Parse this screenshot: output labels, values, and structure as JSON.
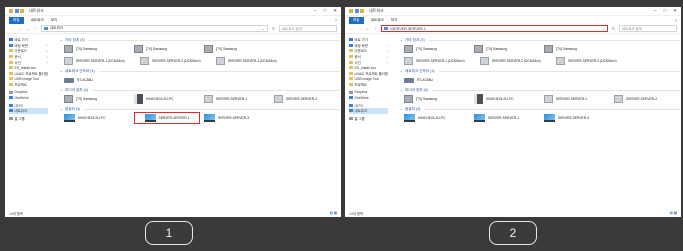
{
  "window_title": "네트워크",
  "ribbon_tabs": [
    "파일",
    "네트워크",
    "보기"
  ],
  "help_icon": "help-icon",
  "search_placeholder": "네트워크 검색",
  "panel1_address": "네트워크",
  "panel2_address": "\\\\SERVER-SERVER-1",
  "nav": [
    {
      "label": "바로 가기",
      "icon": "star-icon"
    },
    {
      "label": "바탕 화면",
      "icon": "desktop-icon"
    },
    {
      "label": "다운로드",
      "icon": "download-icon"
    },
    {
      "label": "문서",
      "icon": "document-icon"
    },
    {
      "label": "사진",
      "icon": "picture-icon"
    },
    {
      "label": "ES_Install.xox",
      "icon": "folder-icon"
    },
    {
      "label": "LiNAC 프로젝트 폴더함",
      "icon": "folder-icon"
    },
    {
      "label": "USB Image Tool",
      "icon": "folder-icon"
    },
    {
      "label": "프로젝트",
      "icon": "folder-icon"
    },
    {
      "label": "Dropbox",
      "icon": "dropbox-icon"
    },
    {
      "label": "OneDrive",
      "icon": "onedrive-icon"
    },
    {
      "label": "내 PC",
      "icon": "pc-icon"
    },
    {
      "label": "네트워크",
      "icon": "network-icon"
    },
    {
      "label": "홈 그룹",
      "icon": "homegroup-icon"
    }
  ],
  "groups": [
    {
      "title": "기타 장치 (4)",
      "items": [
        {
          "label": "[TV] Samsung",
          "icon": "tv-icon"
        },
        {
          "label": "[TV] Samsung",
          "icon": "tv-icon"
        },
        {
          "label": "[TV] Samsung",
          "icon": "tv-icon"
        }
      ]
    },
    {
      "title": "",
      "items": [
        {
          "label": "SERVER-SERVER-1 (DCM15xx)",
          "icon": "media-server-icon"
        },
        {
          "label": "SERVER-SERVER-2 (DCM15xx)",
          "icon": "media-server-icon"
        },
        {
          "label": "SERVER-SERVER-3 (DCM15xx)",
          "icon": "media-server-icon"
        }
      ]
    },
    {
      "title": "네트워크 인프라 (1)",
      "items": [
        {
          "label": "RT-AC88U",
          "icon": "router-icon"
        }
      ]
    },
    {
      "title": "미디어 장치 (4)",
      "items": [
        {
          "label": "[TV] Samsung",
          "icon": "tv-icon"
        },
        {
          "label": "KIMCHEOLSU-PC",
          "icon": "media-pc-icon"
        },
        {
          "label": "SERVER-SERVER-1",
          "icon": "media-server-icon"
        },
        {
          "label": "SERVER-SERVER-2",
          "icon": "media-server-icon"
        }
      ]
    },
    {
      "title": "컴퓨터 (3)",
      "items": [
        {
          "label": "KIMCHEOLSU-PC",
          "icon": "computer-icon"
        },
        {
          "label": "SERVER-SERVER-1",
          "icon": "computer-icon"
        },
        {
          "label": "SERVER-SERVER-3",
          "icon": "computer-icon"
        }
      ]
    }
  ],
  "status_text": "14개 항목",
  "steps": [
    "1",
    "2"
  ],
  "highlight_color": "#e32b2b"
}
